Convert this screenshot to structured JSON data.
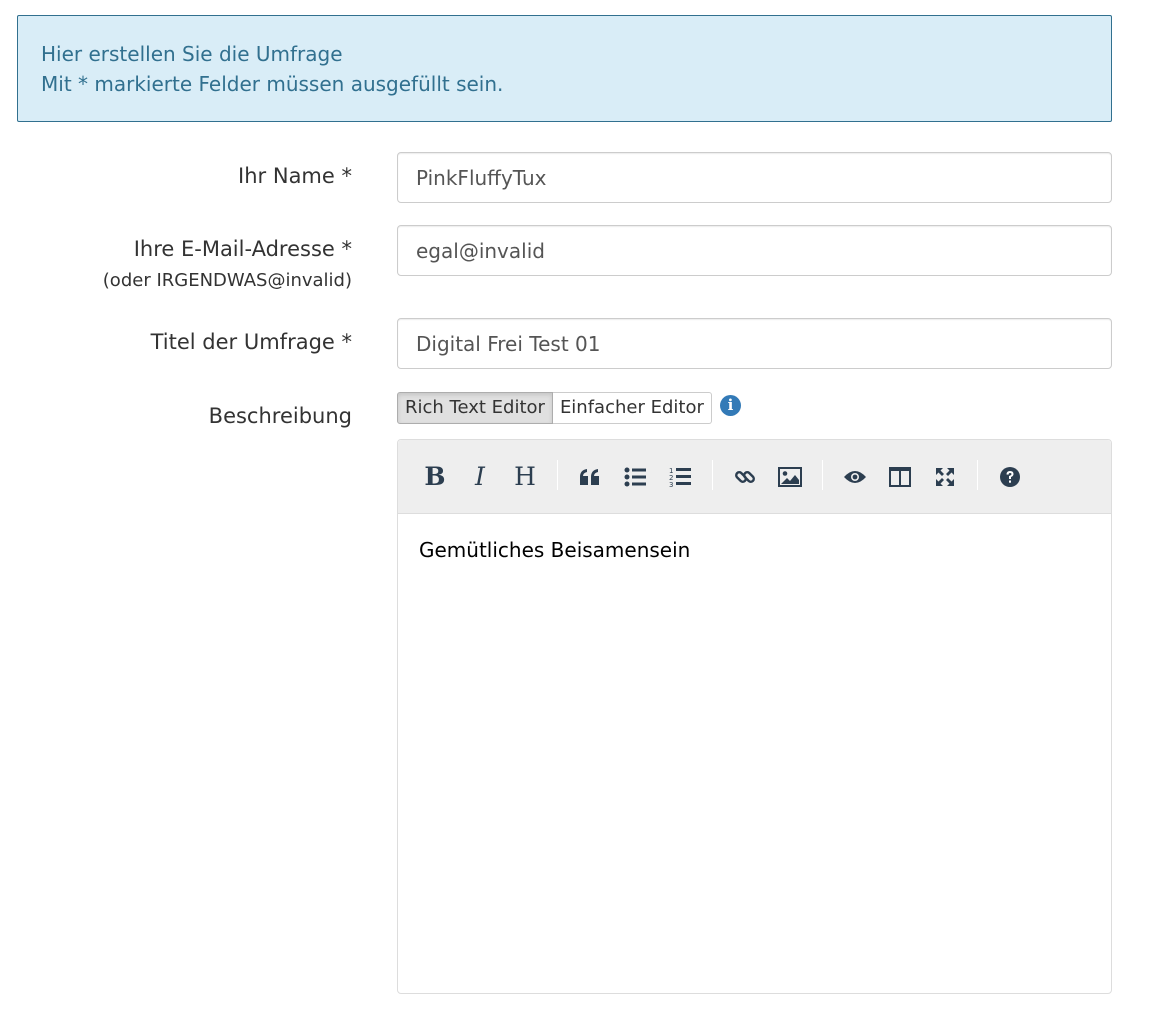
{
  "alert": {
    "line1": "Hier erstellen Sie die Umfrage",
    "line2": "Mit * markierte Felder müssen ausgefüllt sein."
  },
  "form": {
    "name": {
      "label": "Ihr Name *",
      "value": "PinkFluffyTux"
    },
    "email": {
      "label": "Ihre E-Mail-Adresse *",
      "hint": "(oder IRGENDWAS@invalid)",
      "value": "egal@invalid"
    },
    "title": {
      "label": "Titel der Umfrage *",
      "value": "Digital Frei Test 01"
    },
    "description": {
      "label": "Beschreibung",
      "toggle_rich": "Rich Text Editor",
      "toggle_simple": "Einfacher Editor",
      "content": "Gemütliches Beisamensein"
    }
  },
  "toolbar": {
    "bold": "B",
    "italic": "I",
    "heading": "H",
    "icons": [
      "bold-icon",
      "italic-icon",
      "heading-icon",
      "quote-icon",
      "unordered-list-icon",
      "ordered-list-icon",
      "link-icon",
      "image-icon",
      "preview-icon",
      "side-by-side-icon",
      "fullscreen-icon",
      "help-icon"
    ]
  },
  "info_icon_glyph": "i",
  "colors": {
    "alert_bg": "#d9edf7",
    "alert_text": "#31708f",
    "info_blue": "#337ab7",
    "toolbar_bg": "#eeeeee"
  }
}
